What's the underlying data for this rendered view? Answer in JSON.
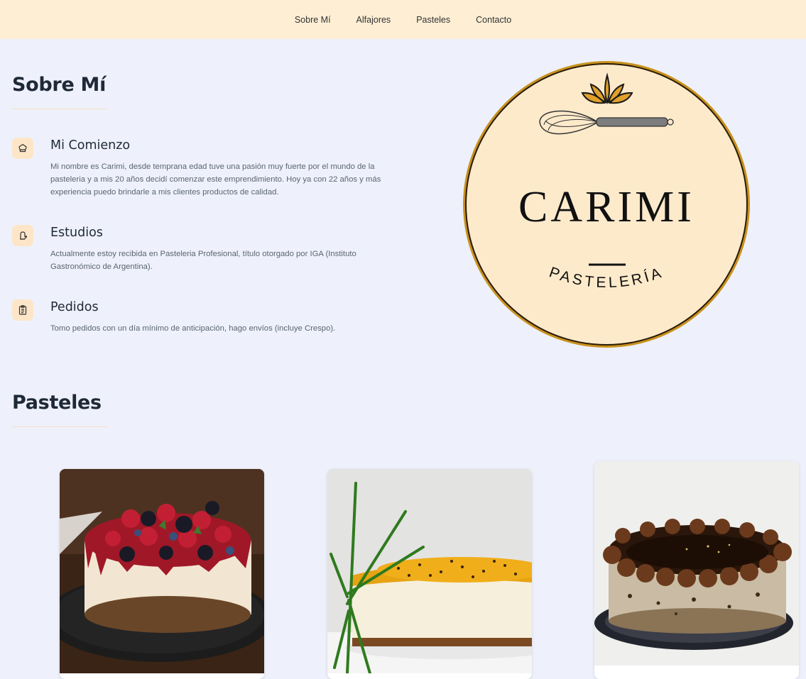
{
  "nav": {
    "items": [
      {
        "label": "Sobre Mí"
      },
      {
        "label": "Alfajores"
      },
      {
        "label": "Pasteles"
      },
      {
        "label": "Contacto"
      }
    ]
  },
  "about": {
    "title": "Sobre Mí",
    "features": [
      {
        "icon": "chef-hat-icon",
        "title": "Mi Comienzo",
        "text": "Mi nombre es Carimi, desde temprana edad tuve una pasión muy fuerte por el mundo de la pasteleria y a mis 20 años decidí comenzar este emprendimiento. Hoy ya con 22 años y más experiencia puedo brindarle a mis clientes productos de calidad."
      },
      {
        "icon": "oven-mitt-icon",
        "title": "Estudios",
        "text": "Actualmente estoy recibida en Pasteleria Profesional, título otorgado por IGA (Instituto Gastronómico de Argentina)."
      },
      {
        "icon": "clipboard-list-icon",
        "title": "Pedidos",
        "text": "Tomo pedidos con un día mínimo de anticipación, hago envíos (incluye Crespo)."
      }
    ]
  },
  "logo": {
    "name": "CARIMI",
    "subtitle": "PASTELERÍA"
  },
  "cakes": {
    "title": "Pasteles",
    "items": [
      {
        "name": "berry-cheesecake-image"
      },
      {
        "name": "passionfruit-cheesecake-image"
      },
      {
        "name": "chocolate-cake-image"
      }
    ]
  },
  "colors": {
    "nav_bg": "#fdeed4",
    "page_bg": "#eef1fb",
    "accent": "#fde6c8",
    "logo_ring": "#c8921e"
  }
}
